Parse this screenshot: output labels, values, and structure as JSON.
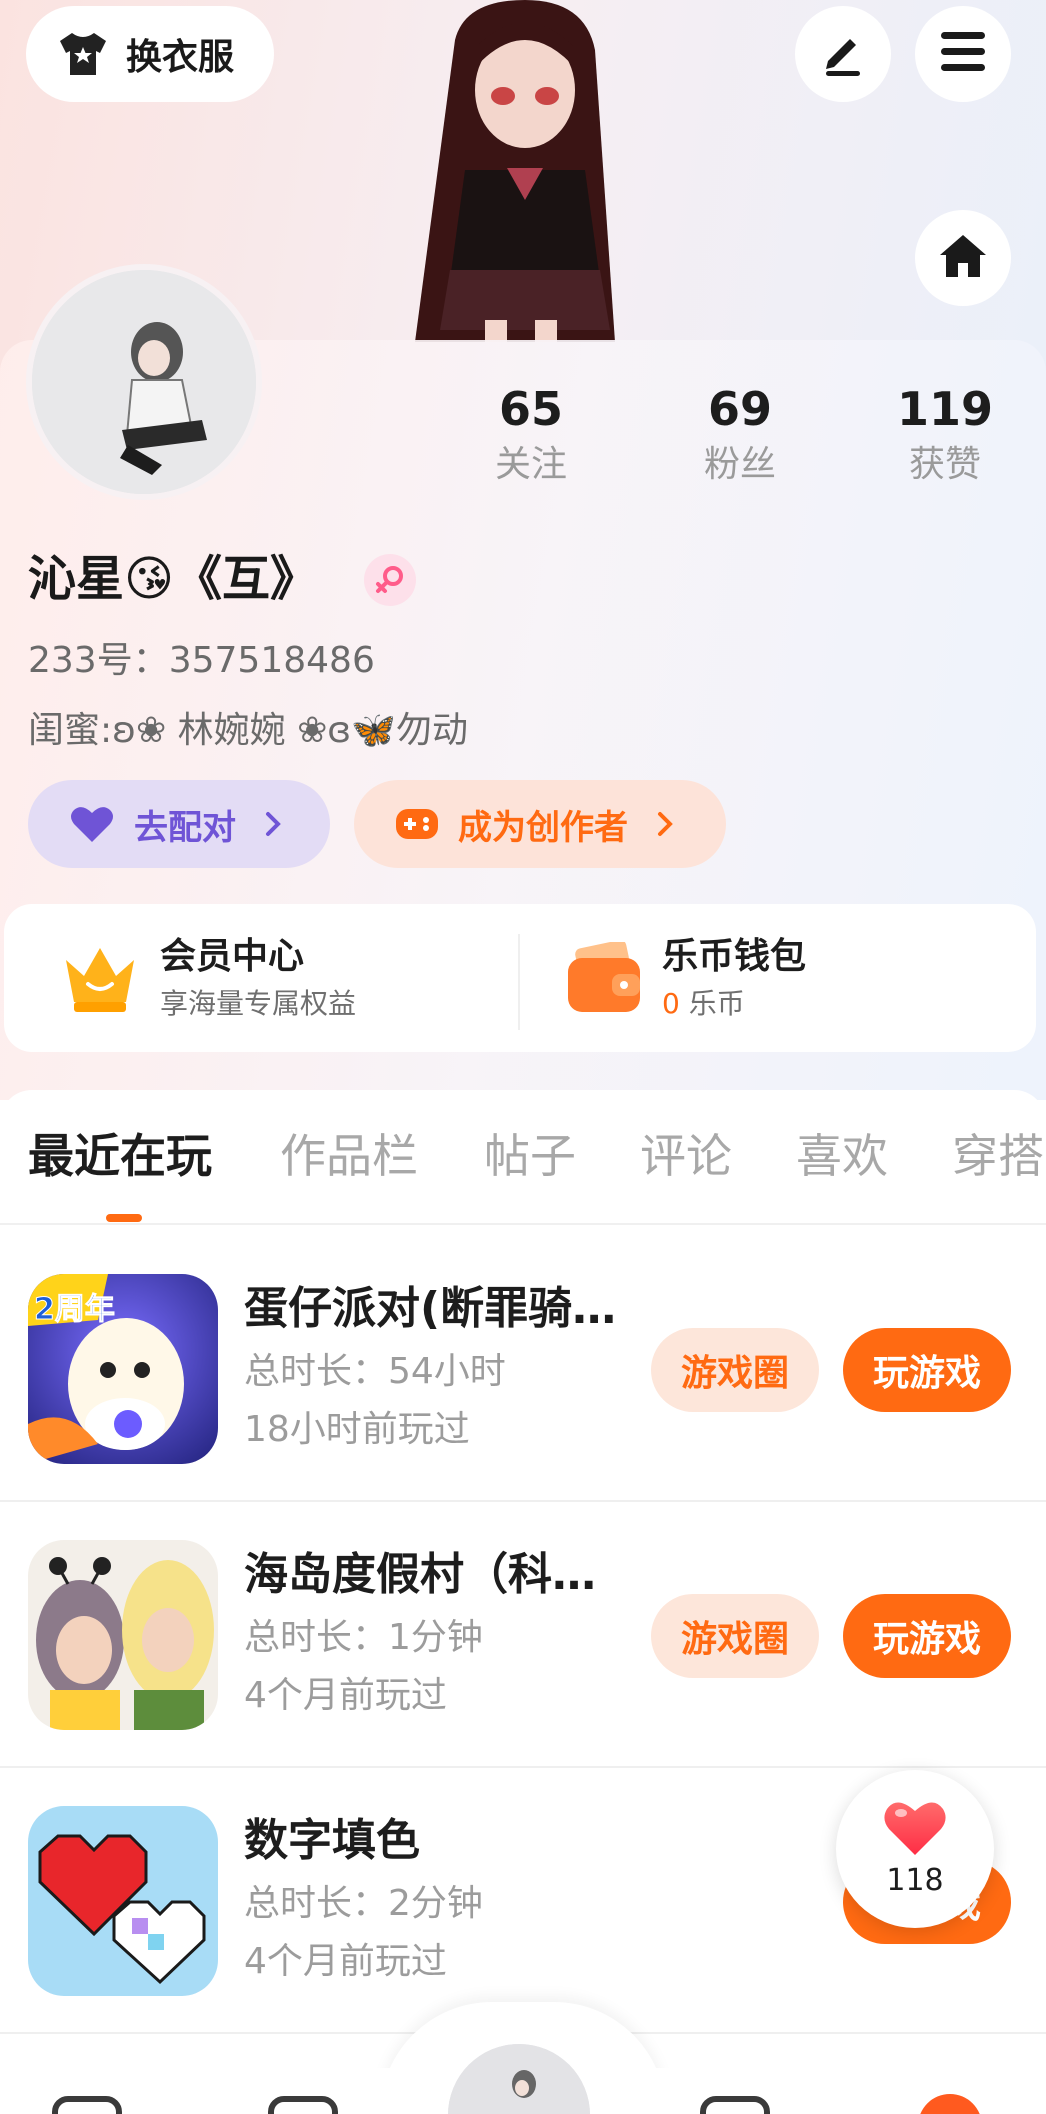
{
  "top_bar": {
    "dress_label": "换衣服"
  },
  "profile": {
    "nickname": "沁星😘《互》",
    "id_line": "233号：357518486",
    "signature": "闺蜜:ʚ❀ 林婉婉 ❀ɞ🦋勿动",
    "stats": [
      {
        "value": "65",
        "label": "关注"
      },
      {
        "value": "69",
        "label": "粉丝"
      },
      {
        "value": "119",
        "label": "获赞"
      }
    ],
    "pair_button": "去配对",
    "creator_button": "成为创作者"
  },
  "wallet": {
    "member_title": "会员中心",
    "member_sub": "享海量专属权益",
    "coin_title": "乐币钱包",
    "coin_amount": "0",
    "coin_unit": "乐币"
  },
  "tabs": [
    "最近在玩",
    "作品栏",
    "帖子",
    "评论",
    "喜欢",
    "穿搭"
  ],
  "games": [
    {
      "name": "蛋仔派对(断罪骑…",
      "duration": "总时长：54小时",
      "last_played": "18小时前玩过",
      "circle_btn": "游戏圈",
      "play_btn": "玩游戏"
    },
    {
      "name": "海岛度假村（科…",
      "duration": "总时长：1分钟",
      "last_played": "4个月前玩过",
      "circle_btn": "游戏圈",
      "play_btn": "玩游戏"
    },
    {
      "name": "数字填色",
      "duration": "总时长：2分钟",
      "last_played": "4个月前玩过",
      "play_btn": "玩游戏"
    }
  ],
  "game_icon_text": {
    "badge": "2周年"
  },
  "like_float": {
    "count": "118"
  },
  "colors": {
    "accent": "#ff6a12",
    "pair_purple": "#6f54d6",
    "heart": "#ff3b4a"
  }
}
